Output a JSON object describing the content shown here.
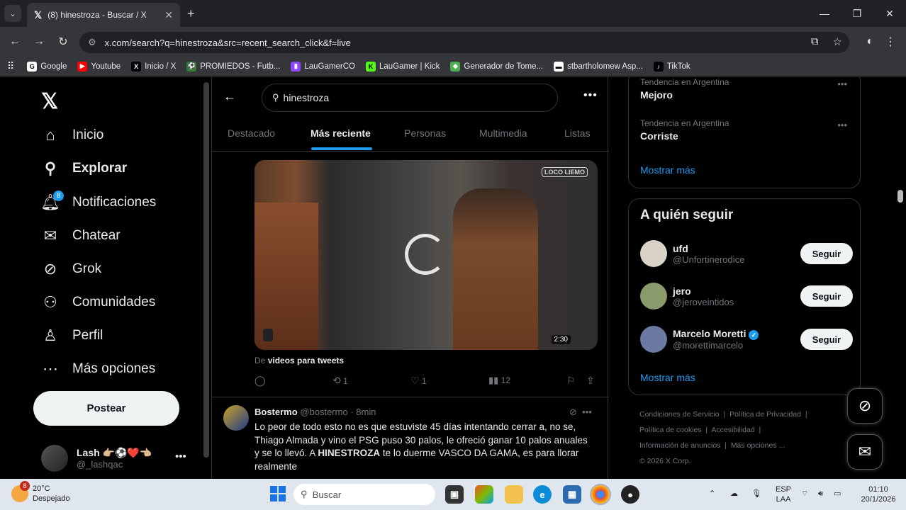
{
  "browser": {
    "tab_title": "(8) hinestroza - Buscar / X",
    "url": "x.com/search?q=hinestroza&src=recent_search_click&f=live",
    "bookmarks": [
      {
        "label": "Google",
        "color": "#fff",
        "icon": "G"
      },
      {
        "label": "Youtube",
        "color": "#ff0000",
        "icon": "▶"
      },
      {
        "label": "Inicio / X",
        "color": "#000",
        "icon": "X"
      },
      {
        "label": "PROMIEDOS - Futb...",
        "color": "#2e7d32",
        "icon": "⚽"
      },
      {
        "label": "LauGamerCO",
        "color": "#9146ff",
        "icon": "▮"
      },
      {
        "label": "LauGamer | Kick",
        "color": "#53fc18",
        "icon": "K"
      },
      {
        "label": "Generador de Tome...",
        "color": "#4caf50",
        "icon": "◆"
      },
      {
        "label": "stbartholomew Asp...",
        "color": "#fff",
        "icon": "▬"
      },
      {
        "label": "TikTok",
        "color": "#000",
        "icon": "♪"
      }
    ]
  },
  "nav": {
    "items": [
      "Inicio",
      "Explorar",
      "Notificaciones",
      "Chatear",
      "Grok",
      "Comunidades",
      "Perfil",
      "Más opciones"
    ],
    "notif_count": "8",
    "post_label": "Postear",
    "account_name": "Lash 👉🏼⚽❤️👈🏼",
    "account_handle": "@_lashqac"
  },
  "search": {
    "query": "hinestroza",
    "tabs": [
      "Destacado",
      "Más reciente",
      "Personas",
      "Multimedia",
      "Listas"
    ],
    "active_tab": "Más reciente"
  },
  "tweet1": {
    "duration": "2:30",
    "watermark": "LOCO LIEMO",
    "from_prefix": "De ",
    "from_source": "videos para tweets",
    "retweets": "1",
    "likes": "1",
    "views": "12"
  },
  "tweet2": {
    "name": "Bostermo",
    "handle": "@bostermo",
    "time": "· 8min",
    "text_before": "Lo peor de todo esto no es que estuviste 45 días intentando cerrar a, no se, Thiago Almada y vino el PSG puso 30 palos, le ofreció ganar 10 palos anuales y se lo llevó. A ",
    "text_bold": "HINESTROZA",
    "text_after": " te lo duerme VASCO DA GAMA, es para llorar realmente"
  },
  "trends": {
    "items": [
      {
        "category": "Tendencia en Argentina",
        "name": "Mejoro"
      },
      {
        "category": "Tendencia en Argentina",
        "name": "Corriste"
      }
    ],
    "show_more": "Mostrar más"
  },
  "who_to_follow": {
    "title": "A quién seguir",
    "users": [
      {
        "name": "ufd",
        "handle": "@Unfortinerodice",
        "verified": false,
        "color": "#d9d4c7"
      },
      {
        "name": "jero",
        "handle": "@jeroveintidos",
        "verified": false,
        "color": "#8a9a6a"
      },
      {
        "name": "Marcelo Moretti",
        "handle": "@morettimarcelo",
        "verified": true,
        "color": "#6a7aa0"
      }
    ],
    "follow_label": "Seguir",
    "show_more": "Mostrar más"
  },
  "footer": {
    "links": [
      "Condiciones de Servicio",
      "Política de Privacidad",
      "Política de cookies",
      "Accesibilidad",
      "Información de anuncios",
      "Más opciones ..."
    ],
    "copyright": "© 2026 X Corp."
  },
  "taskbar": {
    "temp": "20°C",
    "weather": "Despejado",
    "weather_badge": "8",
    "search_placeholder": "Buscar",
    "lang1": "ESP",
    "lang2": "LAA",
    "time": "01:10",
    "date": "20/1/2026"
  }
}
